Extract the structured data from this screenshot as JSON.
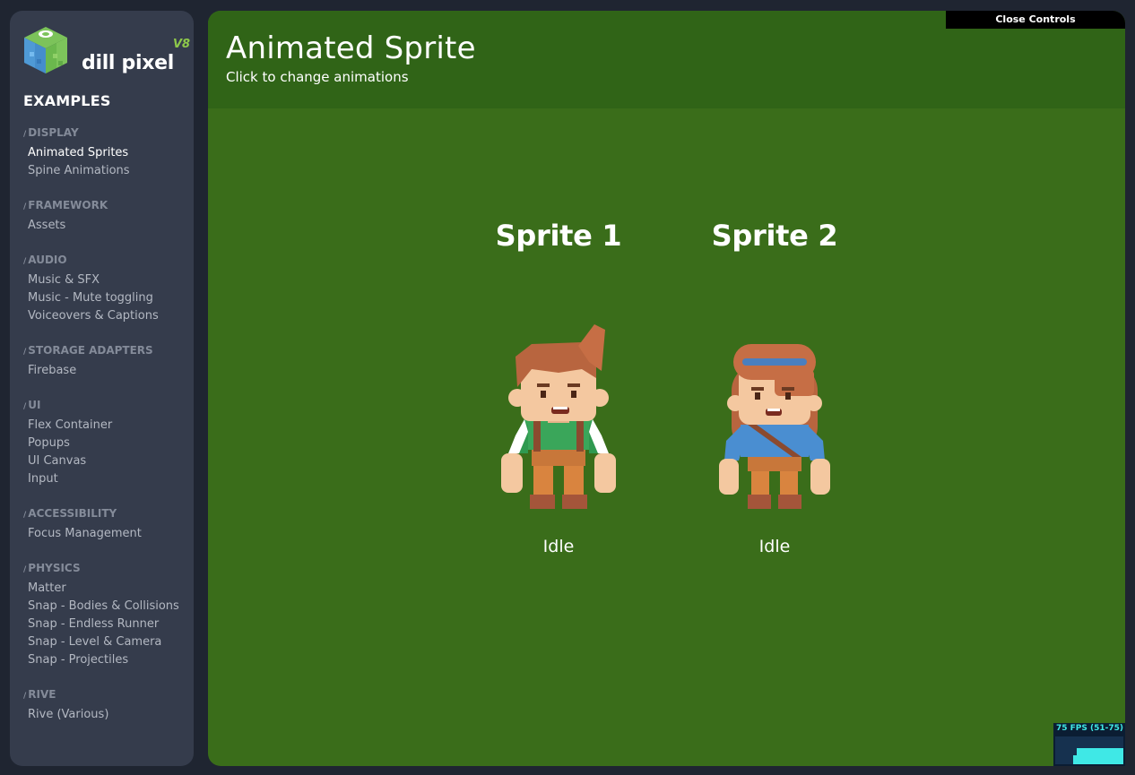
{
  "app": {
    "brand": "dill pixel",
    "version": "V8"
  },
  "sidebar": {
    "title": "EXAMPLES",
    "sections": [
      {
        "title": "DISPLAY",
        "items": [
          "Animated Sprites",
          "Spine Animations"
        ]
      },
      {
        "title": "FRAMEWORK",
        "items": [
          "Assets"
        ]
      },
      {
        "title": "AUDIO",
        "items": [
          "Music & SFX",
          "Music - Mute toggling",
          "Voiceovers & Captions"
        ]
      },
      {
        "title": "STORAGE ADAPTERS",
        "items": [
          "Firebase"
        ]
      },
      {
        "title": "UI",
        "items": [
          "Flex Container",
          "Popups",
          "UI Canvas",
          "Input"
        ]
      },
      {
        "title": "ACCESSIBILITY",
        "items": [
          "Focus Management"
        ]
      },
      {
        "title": "PHYSICS",
        "items": [
          "Matter",
          "Snap - Bodies & Collisions",
          "Snap - Endless Runner",
          "Snap - Level & Camera",
          "Snap - Projectiles"
        ]
      },
      {
        "title": "RIVE",
        "items": [
          "Rive (Various)"
        ]
      }
    ],
    "active_item": "Animated Sprites"
  },
  "header": {
    "title": "Animated Sprite",
    "subtitle": "Click to change animations"
  },
  "controls": {
    "close_label": "Close Controls"
  },
  "sprites": [
    {
      "label": "Sprite 1",
      "animation": "Idle"
    },
    {
      "label": "Sprite 2",
      "animation": "Idle"
    }
  ],
  "fps_meter": {
    "text": "75 FPS (51-75)"
  },
  "colors": {
    "background": "#1f2531",
    "sidebar": "#353c4c",
    "main": "#3a6d1a",
    "header": "#306417",
    "accent": "#8ec94a",
    "fps": "#3fe8e6"
  }
}
